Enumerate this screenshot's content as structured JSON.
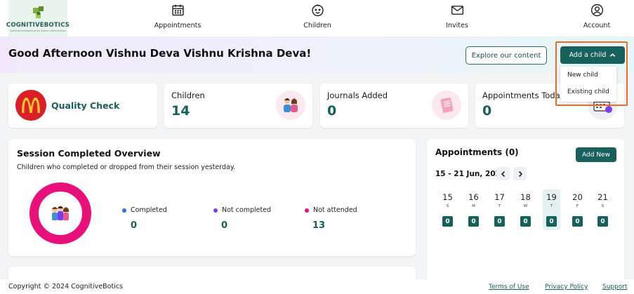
{
  "brand": {
    "name": "COGNITIVEBOTICS",
    "tagline": "Artificial Intelligence for Autism Intervention",
    "accent": "#17605b"
  },
  "nav": {
    "items": [
      {
        "label": "Appointments",
        "icon": "calendar-icon"
      },
      {
        "label": "Children",
        "icon": "child-face-icon"
      },
      {
        "label": "Invites",
        "icon": "mail-icon"
      },
      {
        "label": "Account",
        "icon": "user-circle-icon"
      }
    ]
  },
  "header": {
    "greeting": "Good Afternoon Vishnu Deva Vishnu Krishna Deva!",
    "explore_label": "Explore our content",
    "add_child_label": "Add a child",
    "add_child_menu": [
      "New child",
      "Existing child"
    ]
  },
  "stats": {
    "org_name": "Quality Check",
    "cards": [
      {
        "title": "Children",
        "value": "14",
        "icon": "children-illustration-icon"
      },
      {
        "title": "Journals Added",
        "value": "0",
        "icon": "journal-illustration-icon"
      },
      {
        "title": "Appointments Today",
        "value": "0",
        "icon": "calendar-illustration-icon"
      }
    ]
  },
  "session_overview": {
    "title": "Session Completed Overview",
    "subtitle": "Children who completed or dropped from their session yesterday.",
    "legend": [
      {
        "label": "Completed",
        "value": "0",
        "color": "#2f6fe4"
      },
      {
        "label": "Not completed",
        "value": "0",
        "color": "#7a3cf0"
      },
      {
        "label": "Not attended",
        "value": "13",
        "color": "#e8107a"
      }
    ]
  },
  "appointments": {
    "title": "Appointments (0)",
    "add_new_label": "Add New",
    "range": "15 - 21 Jun, 2025",
    "days": [
      {
        "num": "15",
        "letter": "S",
        "count": "0",
        "selected": false
      },
      {
        "num": "16",
        "letter": "M",
        "count": "0",
        "selected": false
      },
      {
        "num": "17",
        "letter": "T",
        "count": "0",
        "selected": false
      },
      {
        "num": "18",
        "letter": "W",
        "count": "0",
        "selected": false
      },
      {
        "num": "19",
        "letter": "T",
        "count": "0",
        "selected": true
      },
      {
        "num": "20",
        "letter": "F",
        "count": "0",
        "selected": false
      },
      {
        "num": "21",
        "letter": "S",
        "count": "0",
        "selected": false
      }
    ]
  },
  "footer": {
    "copyright": "Copyright © 2024 CognitiveBotics",
    "links": [
      "Terms of Use",
      "Privacy Policy",
      "Support"
    ]
  }
}
